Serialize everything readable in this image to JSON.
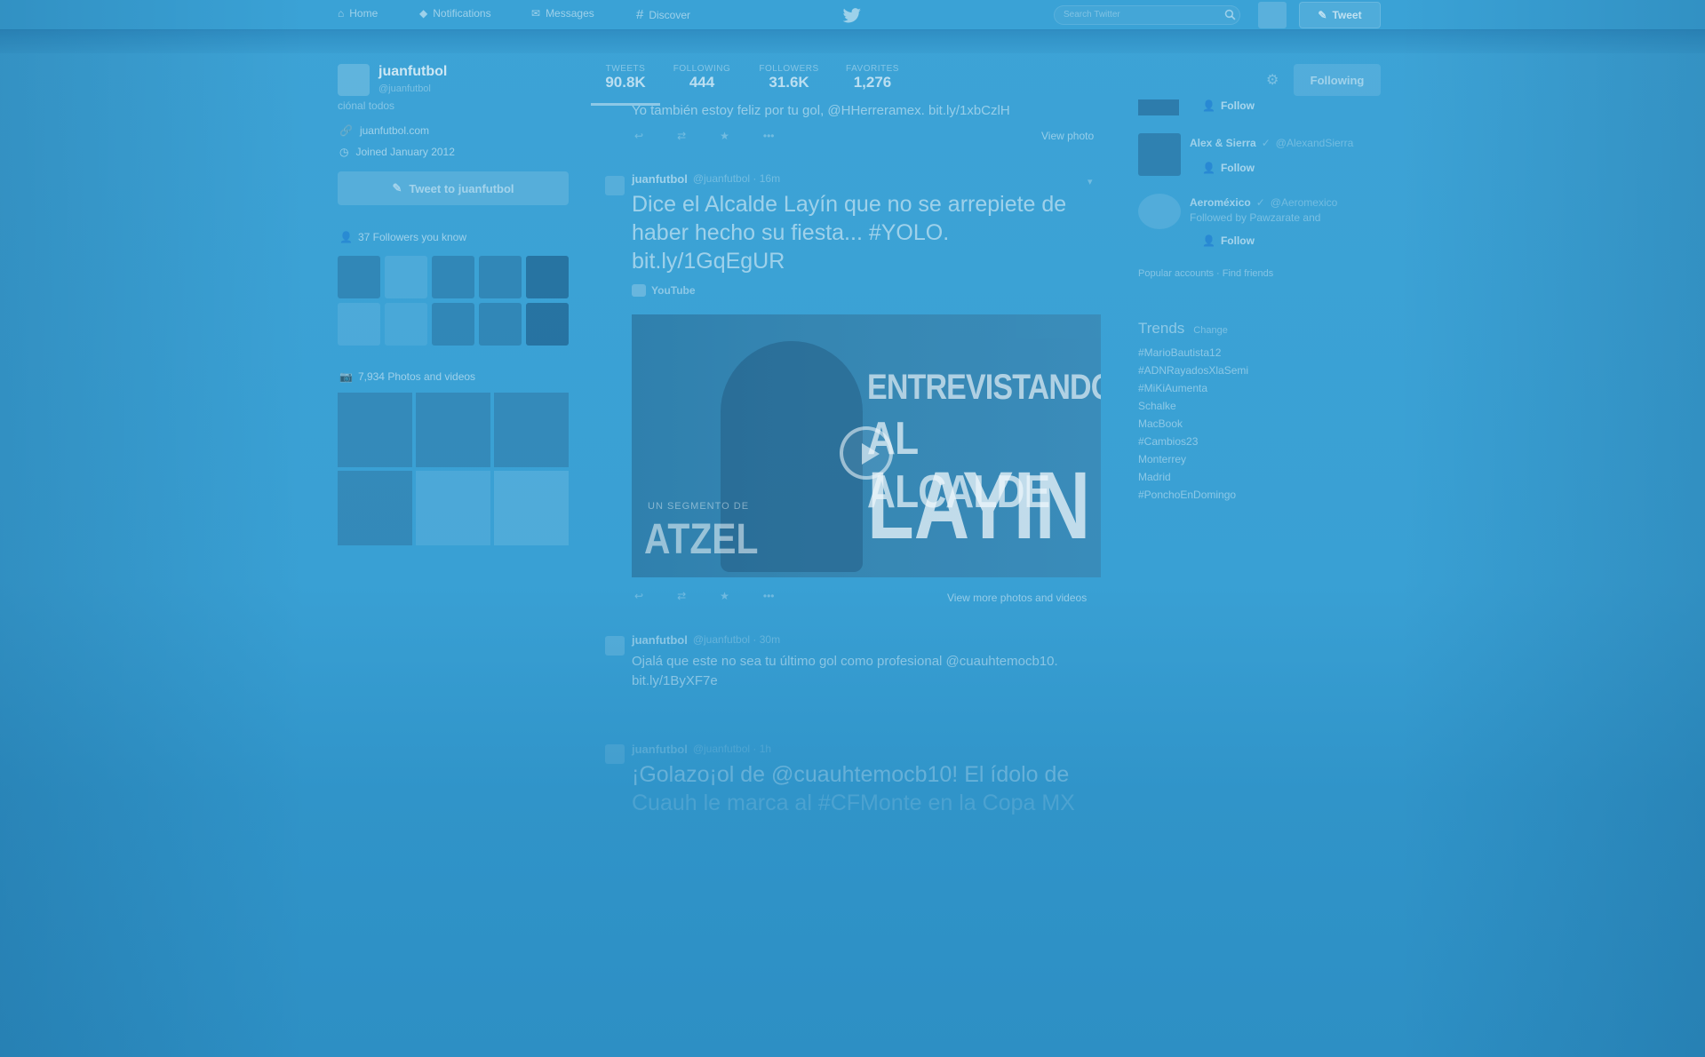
{
  "nav": {
    "home": "Home",
    "notifications": "Notifications",
    "messages": "Messages",
    "discover": "Discover",
    "search_placeholder": "Search Twitter",
    "tweet_button": "Tweet"
  },
  "profile": {
    "name": "juanfutbol",
    "handle": "@juanfutbol",
    "bio_tail": "ciónal todos",
    "website": "juanfutbol.com",
    "joined": "Joined January 2012",
    "tweet_to": "Tweet to juanfutbol",
    "followers_you_know": "37 Followers you know",
    "photos_videos": "7,934 Photos and videos"
  },
  "stats": [
    {
      "label": "TWEETS",
      "value": "90.8K"
    },
    {
      "label": "FOLLOWING",
      "value": "444"
    },
    {
      "label": "FOLLOWERS",
      "value": "31.6K"
    },
    {
      "label": "FAVORITES",
      "value": "1,276"
    }
  ],
  "following_button": "Following",
  "tweets": {
    "t0_text": "Yo también estoy feliz por tu gol, @HHerreramex. bit.ly/1xbCzlH",
    "t0_view": "View photo",
    "t1_name": "juanfutbol",
    "t1_meta": "@juanfutbol · 16m",
    "t1_line1": "Dice el Alcalde Layín que no se arrepiete de",
    "t1_line2": "haber hecho su fiesta... #YOLO.",
    "t1_line3": "bit.ly/1GqEgUR",
    "t1_source": "YouTube",
    "t1_view_more": "View more photos and videos",
    "t2_name": "juanfutbol",
    "t2_meta": "@juanfutbol · 30m",
    "t2_line1": "Ojalá que este no sea tu último gol como profesional @cuauhtemocb10.",
    "t2_line2": "bit.ly/1ByXF7e",
    "t3_name": "juanfutbol",
    "t3_meta": "@juanfutbol · 1h",
    "t3_line1": "¡Golazo¡ol de @cuauhtemocb10! El ídolo de",
    "t3_line2": "Cuauh le marca al #CFMonte en la Copa MX"
  },
  "media": {
    "title_1": "ENTREVISTANDO",
    "title_2": "AL ALCALDE",
    "title_3": "LAYIN",
    "brand_small": "UN SEGMENTO DE",
    "brand": "ATZEL"
  },
  "who_to_follow": [
    {
      "name": "",
      "handle": "",
      "action": "Follow"
    },
    {
      "name": "Alex & Sierra",
      "handle": "@AlexandSierra",
      "action": "Follow"
    },
    {
      "name": "Aeroméxico",
      "handle": "@Aeromexico",
      "followed_by": "Followed by Pawzarate and",
      "action": "Follow"
    }
  ],
  "wtf_links": "Popular accounts · Find friends",
  "trends": {
    "title": "Trends",
    "change": "Change",
    "items": [
      "#MarioBautista12",
      "#ADNRayadosXlaSemi",
      "#MiKiAumenta",
      "Schalke",
      "MacBook",
      "#Cambios23",
      "Monterrey",
      "Madrid",
      "#PonchoEnDomingo"
    ]
  }
}
